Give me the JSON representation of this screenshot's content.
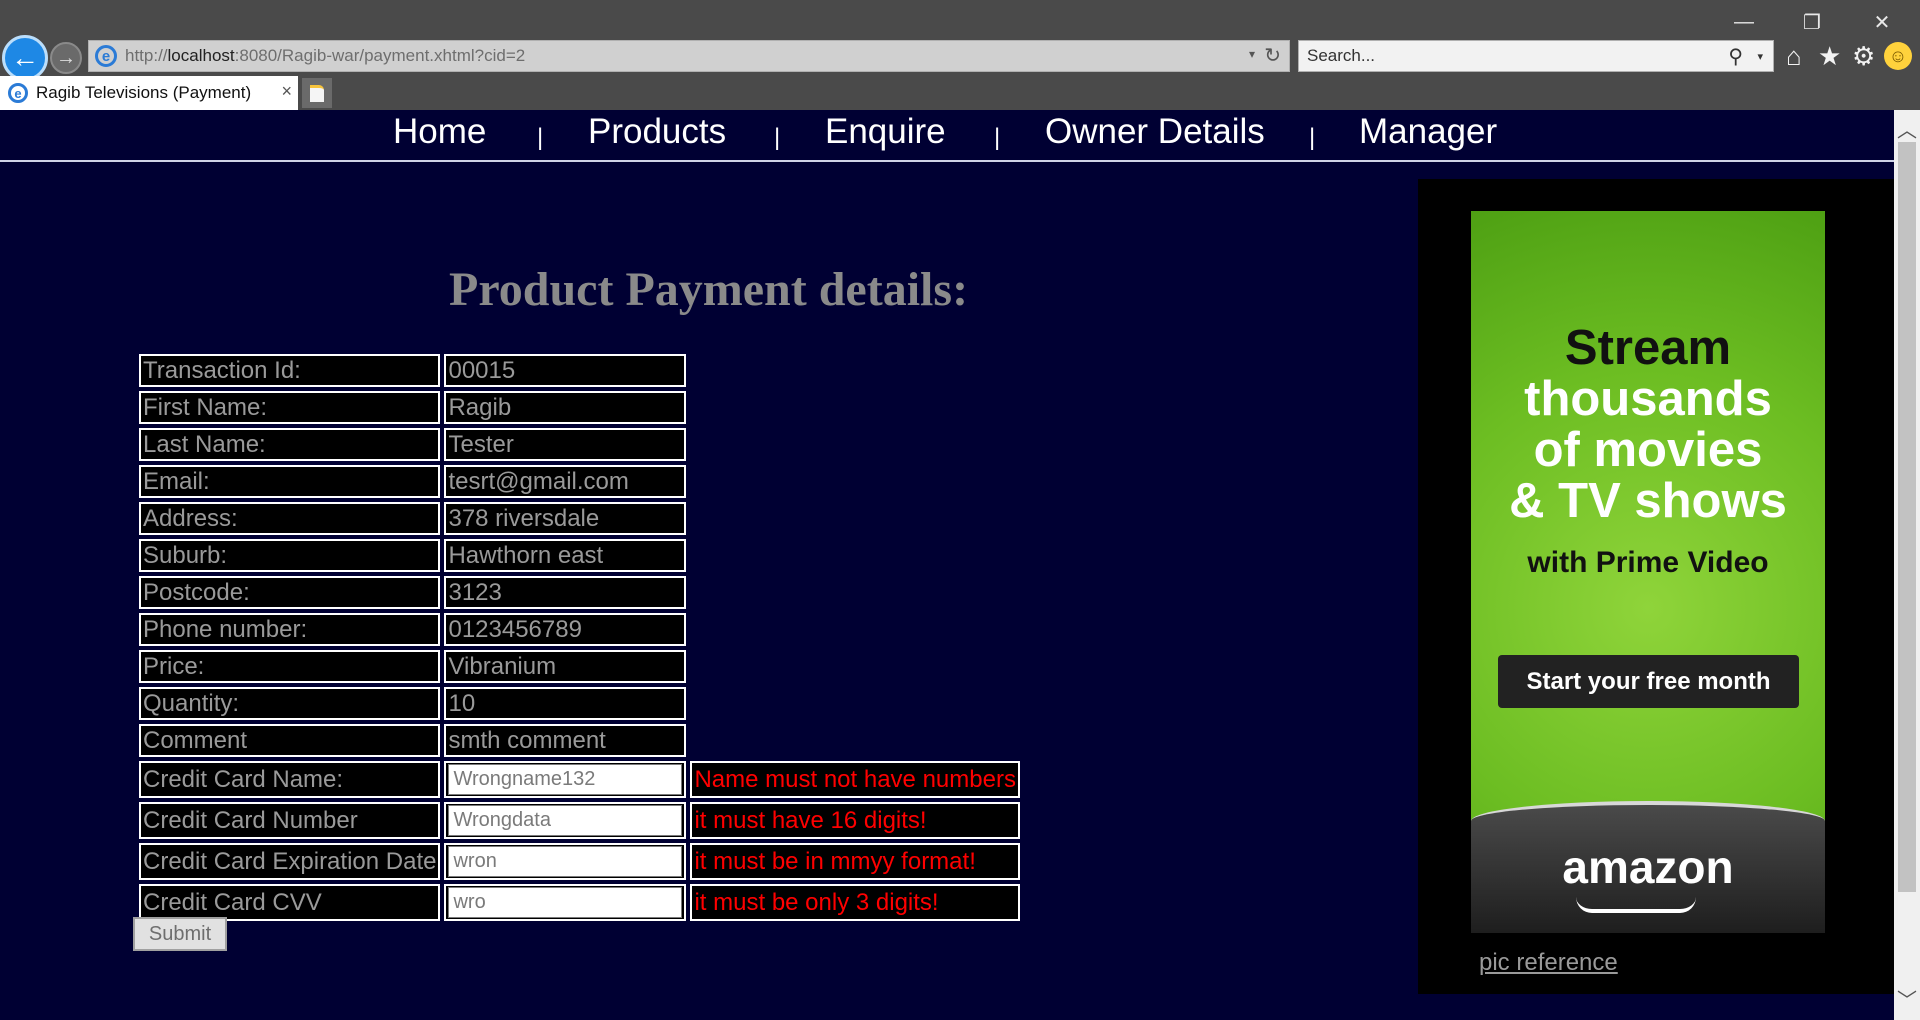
{
  "browser": {
    "url_prefix": "http://",
    "url_host": "localhost",
    "url_rest": ":8080/Ragib-war/payment.xhtml?cid=2",
    "search_placeholder": "Search...",
    "tab_title": "Ragib Televisions (Payment)",
    "tab_close": "×",
    "minimize": "—",
    "restore": "❐",
    "close": "✕",
    "back_glyph": "←",
    "forward_glyph": "→",
    "refresh_glyph": "↻",
    "dropdown_glyph": "▾",
    "search_glyph": "⚲",
    "home_glyph": "⌂",
    "star_glyph": "★",
    "gear_glyph": "⚙",
    "smiley_glyph": "☺",
    "ie_glyph": "e"
  },
  "nav": {
    "items": [
      "Home",
      "Products",
      "Enquire",
      "Owner Details",
      "Manager"
    ],
    "separator": "|"
  },
  "page": {
    "title": "Product Payment details:"
  },
  "form": {
    "rows": [
      {
        "label": "Transaction Id:",
        "value": "00015"
      },
      {
        "label": "First Name:",
        "value": "Ragib"
      },
      {
        "label": "Last Name:",
        "value": "Tester"
      },
      {
        "label": "Email:",
        "value": "tesrt@gmail.com"
      },
      {
        "label": "Address:",
        "value": "378 riversdale"
      },
      {
        "label": "Suburb:",
        "value": "Hawthorn east"
      },
      {
        "label": "Postcode:",
        "value": "3123"
      },
      {
        "label": "Phone number:",
        "value": "0123456789"
      },
      {
        "label": "Price:",
        "value": "Vibranium"
      },
      {
        "label": "Quantity:",
        "value": "10"
      },
      {
        "label": "Comment",
        "value": "smth comment"
      }
    ],
    "inputs": [
      {
        "label": "Credit Card Name:",
        "value": "Wrongname132",
        "error": "Name must not have numbers"
      },
      {
        "label": "Credit Card Number",
        "value": "Wrongdata",
        "error": "it must have 16 digits!"
      },
      {
        "label": "Credit Card Expiration Date",
        "value": "wron",
        "error": "it must be in mmyy format!"
      },
      {
        "label": "Credit Card CVV",
        "value": "wro",
        "error": "it must be only 3 digits!"
      }
    ],
    "submit_label": "Submit"
  },
  "ad": {
    "headline_lines": [
      "Stream",
      "thousands",
      "of movies",
      "& TV shows"
    ],
    "subline": "with Prime Video",
    "cta": "Start your free month",
    "logo_text": "amazon",
    "reference_link": "pic reference"
  },
  "scrollbar": {
    "up_glyph": "︿",
    "down_glyph": "﹀"
  },
  "colors": {
    "page_background": "#000033",
    "error_text": "#ff0000",
    "ad_green": "#6cbd22"
  }
}
